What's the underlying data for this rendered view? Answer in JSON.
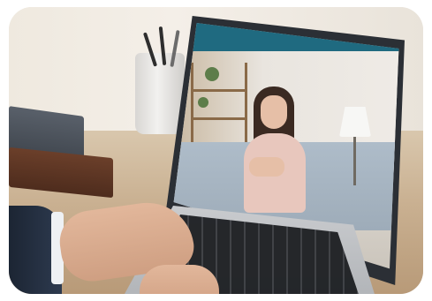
{
  "scene": {
    "colors": {
      "call_bar": "#1f6a80",
      "control_blue": "#2f8fe0",
      "end_call_red": "#e23b3b"
    }
  },
  "video_call": {
    "top_controls": [
      {
        "icon": "minimize-icon"
      },
      {
        "icon": "more-icon"
      }
    ],
    "controls": [
      {
        "icon": "camera-icon",
        "color": "#2f8fe0"
      },
      {
        "icon": "speaker-icon",
        "color": "#2f8fe0"
      },
      {
        "icon": "microphone-icon",
        "color": "#2f8fe0"
      },
      {
        "icon": "end-call-icon",
        "color": "#e23b3b"
      }
    ]
  }
}
